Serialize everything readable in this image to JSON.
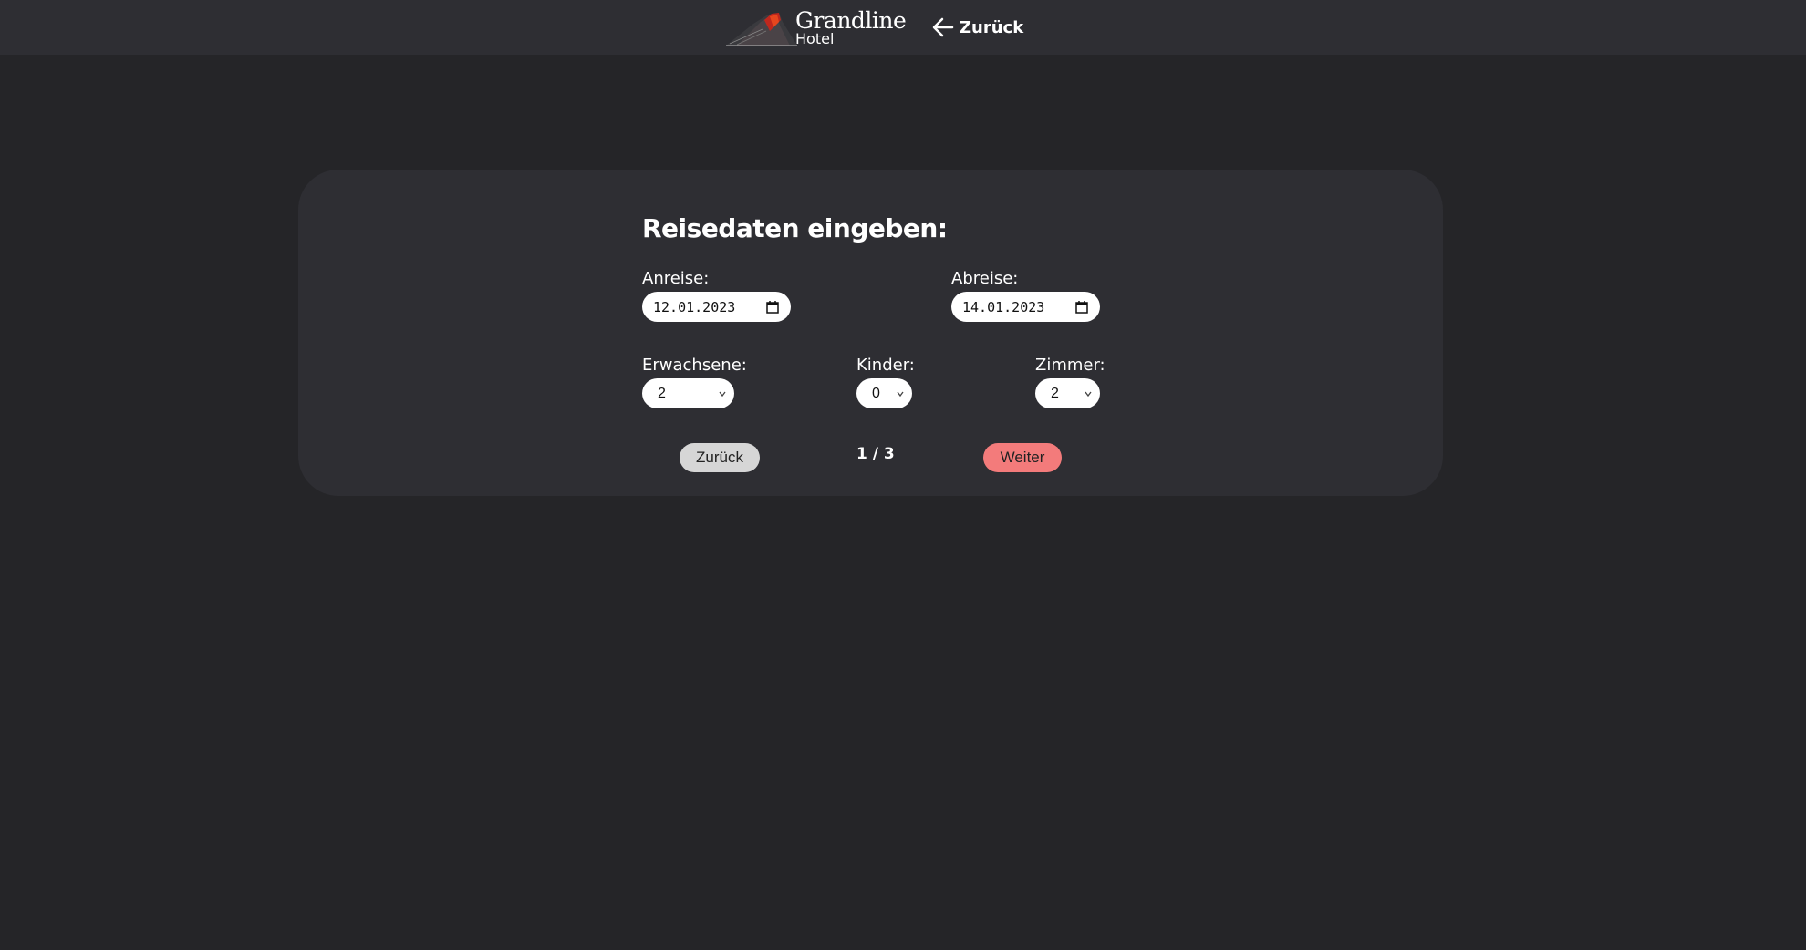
{
  "header": {
    "logo_title": "Grandline",
    "logo_subtitle": "Hotel",
    "back_label": "Zurück"
  },
  "form": {
    "title": "Reisedaten eingeben:",
    "arrival_label": "Anreise:",
    "arrival_value": "12.01.2023",
    "departure_label": "Abreise:",
    "departure_value": "14.01.2023",
    "adults_label": "Erwachsene:",
    "adults_value": "2",
    "children_label": "Kinder:",
    "children_value": "0",
    "rooms_label": "Zimmer:",
    "rooms_value": "2"
  },
  "nav": {
    "back_label": "Zurück",
    "pager": "1 / 3",
    "next_label": "Weiter"
  },
  "colors": {
    "background": "#252528",
    "panel": "#2e2e33",
    "accent": "#f37b7b",
    "secondary_button": "#d6d6d6"
  }
}
